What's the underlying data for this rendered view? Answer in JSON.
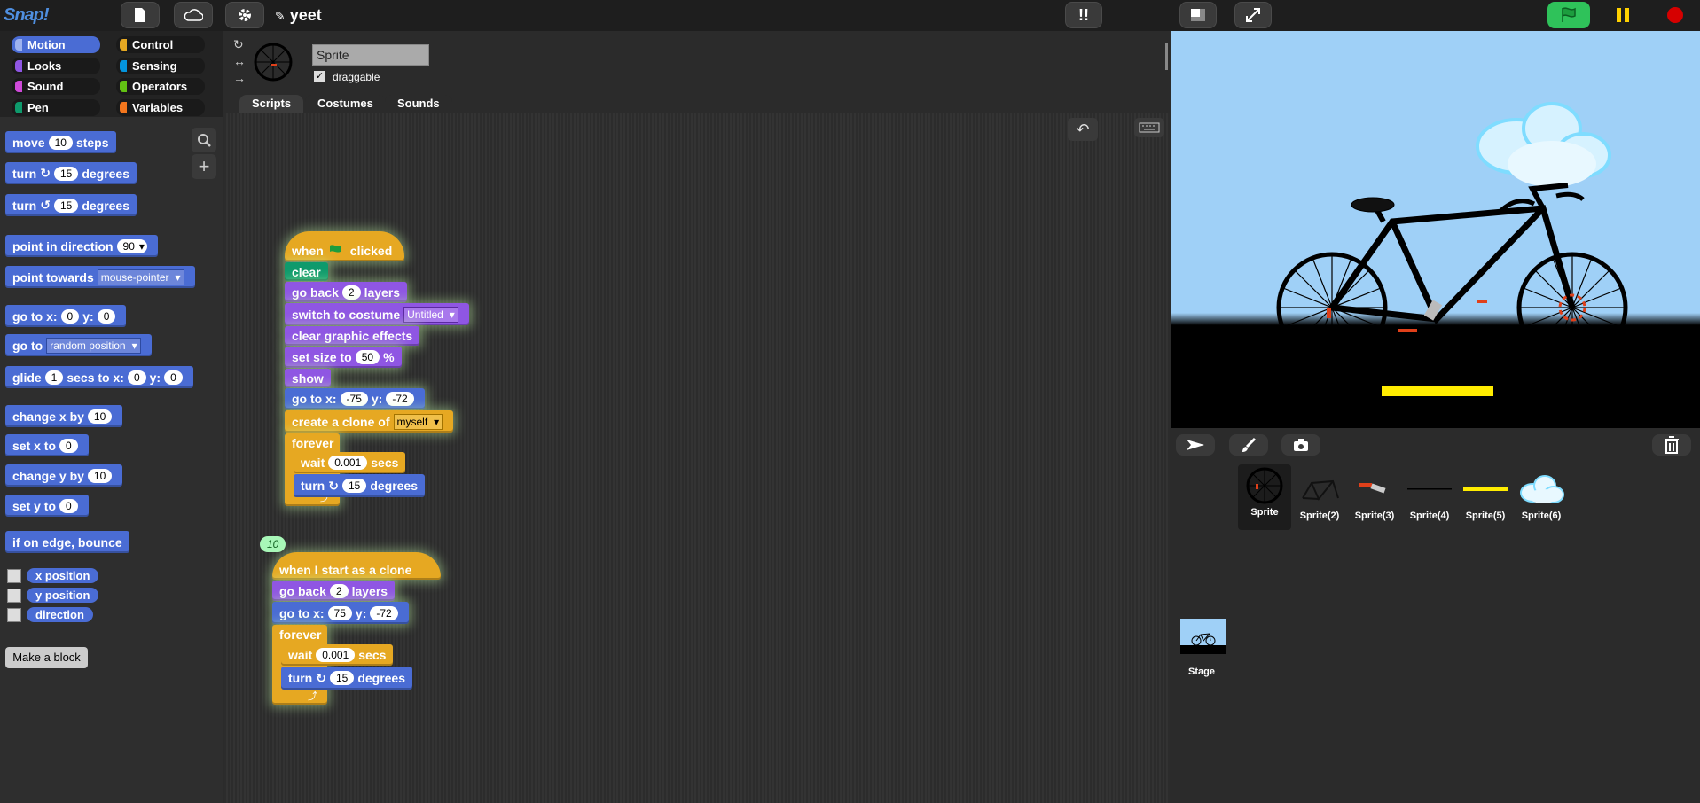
{
  "app": {
    "logo": "Snap!",
    "project_name": "yeet"
  },
  "categories": [
    {
      "label": "Motion",
      "color": "#4a6cd4",
      "selected": true
    },
    {
      "label": "Control",
      "color": "#e6a822"
    },
    {
      "label": "Looks",
      "color": "#8f56e3"
    },
    {
      "label": "Sensing",
      "color": "#0494dc"
    },
    {
      "label": "Sound",
      "color": "#cf4ad9"
    },
    {
      "label": "Operators",
      "color": "#62c213"
    },
    {
      "label": "Pen",
      "color": "#0e9a6c"
    },
    {
      "label": "Variables",
      "color": "#f3761d"
    }
  ],
  "palette": {
    "move": {
      "a": "move",
      "v": "10",
      "b": "steps"
    },
    "turn_cw": {
      "a": "turn",
      "v": "15",
      "b": "degrees"
    },
    "turn_ccw": {
      "a": "turn",
      "v": "15",
      "b": "degrees"
    },
    "point_dir": {
      "a": "point in direction",
      "v": "90"
    },
    "point_towards": {
      "a": "point towards",
      "v": "mouse-pointer"
    },
    "goto_xy": {
      "a": "go to x:",
      "x": "0",
      "b": "y:",
      "y": "0"
    },
    "goto": {
      "a": "go to",
      "v": "random position"
    },
    "glide": {
      "a": "glide",
      "v": "1",
      "b": "secs to x:",
      "x": "0",
      "c": "y:",
      "y": "0"
    },
    "change_x": {
      "a": "change x by",
      "v": "10"
    },
    "set_x": {
      "a": "set x to",
      "v": "0"
    },
    "change_y": {
      "a": "change y by",
      "v": "10"
    },
    "set_y": {
      "a": "set y to",
      "v": "0"
    },
    "bounce": "if on edge, bounce",
    "reporters": [
      "x position",
      "y position",
      "direction"
    ],
    "make_block": "Make a block"
  },
  "sprite": {
    "name": "Sprite",
    "draggable_label": "draggable",
    "draggable": true
  },
  "tabs": [
    "Scripts",
    "Costumes",
    "Sounds"
  ],
  "script1": {
    "hat": {
      "a": "when",
      "b": "clicked"
    },
    "clear": "clear",
    "go_back": {
      "a": "go back",
      "v": "2",
      "b": "layers"
    },
    "switch_costume": {
      "a": "switch to costume",
      "v": "Untitled"
    },
    "clear_effects": "clear graphic effects",
    "set_size": {
      "a": "set size to",
      "v": "50",
      "b": "%"
    },
    "show": "show",
    "goto": {
      "a": "go to x:",
      "x": "-75",
      "b": "y:",
      "y": "-72"
    },
    "clone": {
      "a": "create a clone of",
      "v": "myself"
    },
    "forever": "forever",
    "wait": {
      "a": "wait",
      "v": "0.001",
      "b": "secs"
    },
    "turn": {
      "a": "turn",
      "v": "15",
      "b": "degrees"
    }
  },
  "bubble": "10",
  "script2": {
    "hat": "when I start as a clone",
    "go_back": {
      "a": "go back",
      "v": "2",
      "b": "layers"
    },
    "goto": {
      "a": "go to x:",
      "x": "75",
      "b": "y:",
      "y": "-72"
    },
    "forever": "forever",
    "wait": {
      "a": "wait",
      "v": "0.001",
      "b": "secs"
    },
    "turn": {
      "a": "turn",
      "v": "15",
      "b": "degrees"
    }
  },
  "corral": {
    "sprites": [
      "Sprite",
      "Sprite(2)",
      "Sprite(3)",
      "Sprite(4)",
      "Sprite(5)",
      "Sprite(6)"
    ],
    "stage_label": "Stage"
  }
}
